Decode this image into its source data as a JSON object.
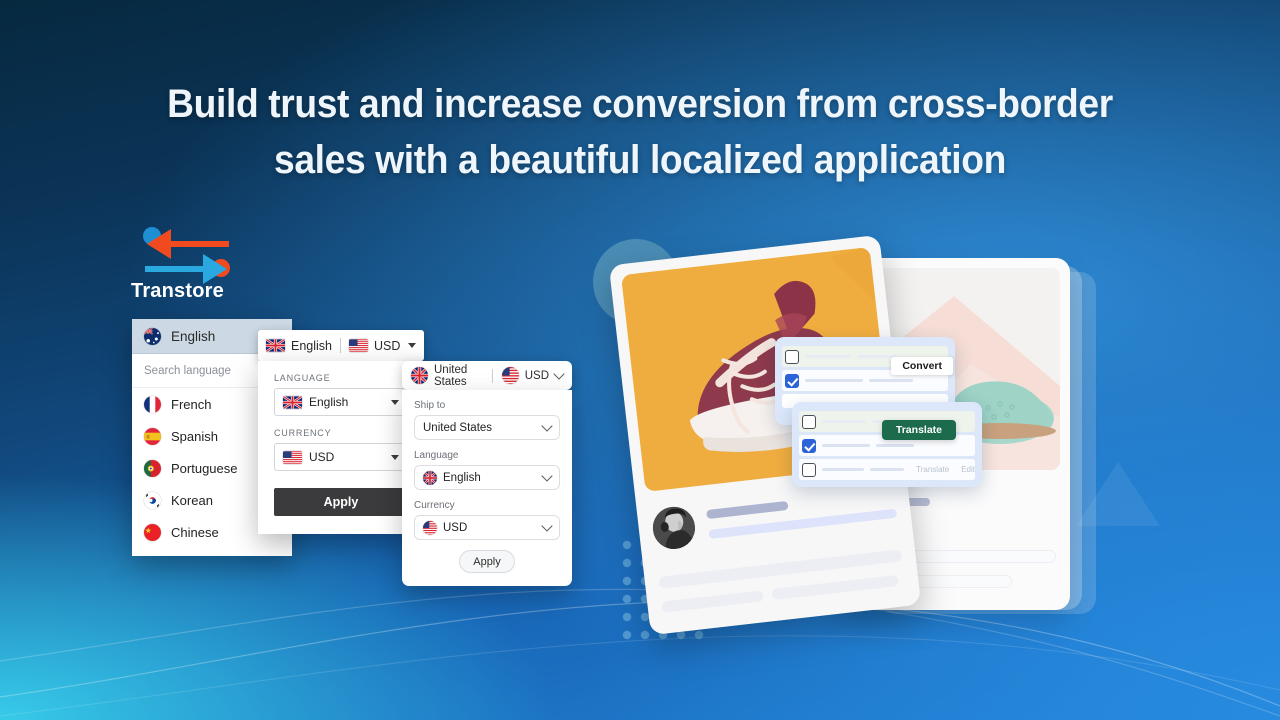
{
  "headline": {
    "line1": "Build trust and increase conversion from cross-border",
    "line2": "sales with a beautiful localized application"
  },
  "brand": {
    "name": "Transtore",
    "logo_icon": "two-way-arrows-icon",
    "arrow_left_color": "#f04a1e",
    "arrow_right_color": "#2aa8e0",
    "dot_blue": "#1f8fd4",
    "dot_orange": "#f04a1e"
  },
  "theme": {
    "background_dark": "#06293f",
    "background_mid": "#11497e",
    "background_bright": "#2383d6",
    "background_cyan": "#37cbe8",
    "accent_blue": "#2a64d8",
    "accent_green": "#1c6b4d",
    "apply_dark": "#3b3b3d"
  },
  "language_panel": {
    "name": "language-selector-dropdown",
    "selected": {
      "label": "English",
      "flag": "australia-flag-icon"
    },
    "search_placeholder": "Search language",
    "options": [
      {
        "label": "French",
        "flag": "france-flag-icon"
      },
      {
        "label": "Spanish",
        "flag": "spain-flag-icon"
      },
      {
        "label": "Portuguese",
        "flag": "portugal-flag-icon"
      },
      {
        "label": "Korean",
        "flag": "south-korea-flag-icon"
      },
      {
        "label": "Chinese",
        "flag": "china-flag-icon"
      }
    ]
  },
  "switcher_classic": {
    "name": "language-currency-switcher",
    "bar": {
      "language": "English",
      "language_flag": "united-kingdom-flag-icon",
      "currency": "USD",
      "currency_flag": "united-states-flag-icon",
      "caret": "caret-down-icon"
    },
    "language_label": "LANGUAGE",
    "language_value": "English",
    "currency_label": "CURRENCY",
    "currency_value": "USD",
    "apply_label": "Apply"
  },
  "switcher_modern": {
    "name": "country-language-currency-switcher",
    "bar": {
      "country": "United States",
      "country_flag": "united-kingdom-flag-icon",
      "currency": "USD",
      "currency_flag": "united-states-flag-icon",
      "chevron": "chevron-down-icon"
    },
    "ship_to_label": "Ship to",
    "ship_to_value": "United States",
    "language_label": "Language",
    "language_value": "English",
    "currency_label": "Currency",
    "currency_value": "USD",
    "apply_label": "Apply"
  },
  "product_mockup": {
    "front_card": {
      "name": "product-card-front",
      "image": "maroon-sneaker-photo",
      "image_bg": "#f0ad3f",
      "avatar": "user-avatar-photo"
    },
    "back_card": {
      "name": "product-card-back",
      "image": "mint-shoe-photo",
      "image_bg": "#f3f1ee"
    }
  },
  "convert_panel": {
    "name": "currency-convert-panel",
    "button_label": "Convert",
    "rows": [
      {
        "checked": false
      },
      {
        "checked": true
      }
    ]
  },
  "translate_panel": {
    "name": "product-translate-panel",
    "button_label": "Translate",
    "secondary_label": "Translate",
    "edit_label": "Edit",
    "rows": [
      {
        "checked": false
      },
      {
        "checked": true
      },
      {
        "checked": false
      }
    ]
  }
}
